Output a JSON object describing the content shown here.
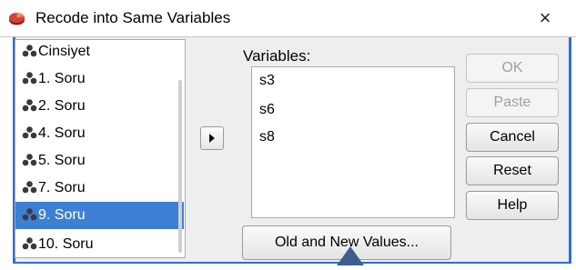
{
  "window": {
    "title": "Recode into Same Variables",
    "title_icon": "spss-pie-icon",
    "close_glyph": "×"
  },
  "source_list": {
    "items": [
      {
        "label": "Cinsiyet",
        "icon": "nominal-variable-icon",
        "selected": false
      },
      {
        "label": "1. Soru",
        "icon": "nominal-variable-icon",
        "selected": false
      },
      {
        "label": "2. Soru",
        "icon": "nominal-variable-icon",
        "selected": false
      },
      {
        "label": "4. Soru",
        "icon": "nominal-variable-icon",
        "selected": false
      },
      {
        "label": "5. Soru",
        "icon": "nominal-variable-icon",
        "selected": false
      },
      {
        "label": "7. Soru",
        "icon": "nominal-variable-icon",
        "selected": false
      },
      {
        "label": "9. Soru",
        "icon": "nominal-variable-icon",
        "selected": true
      },
      {
        "label": "10. Soru",
        "icon": "nominal-variable-icon",
        "selected": false
      }
    ]
  },
  "move_button": {
    "icon": "arrow-right-icon"
  },
  "variables": {
    "label": "Variables:",
    "items": [
      "s3",
      "s6",
      "s8"
    ]
  },
  "old_new_button": {
    "label": "Old and New Values..."
  },
  "buttons": {
    "ok": {
      "label": "OK",
      "enabled": false
    },
    "paste": {
      "label": "Paste",
      "enabled": false
    },
    "cancel": {
      "label": "Cancel",
      "enabled": true
    },
    "reset": {
      "label": "Reset",
      "enabled": true
    },
    "help": {
      "label": "Help",
      "enabled": true
    }
  },
  "colors": {
    "selection": "#3d7fd3",
    "frame_accent": "#2b6fd6",
    "pointer": "#3e5f8a",
    "icon_red": "#c9302c"
  }
}
